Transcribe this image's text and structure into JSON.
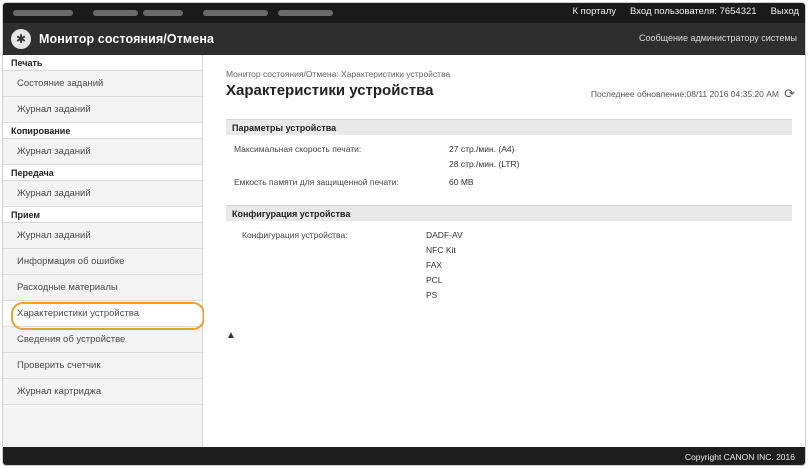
{
  "topbar": {
    "portal": "К порталу",
    "user": "Вход пользователя: 7654321",
    "logout": "Выход"
  },
  "header": {
    "title": "Монитор состояния/Отмена",
    "admin_msg": "Сообщение администратору системы"
  },
  "sidebar": {
    "sections": [
      {
        "heading": "Печать",
        "items": [
          "Состояние заданий",
          "Журнал заданий"
        ]
      },
      {
        "heading": "Копирование",
        "items": [
          "Журнал заданий"
        ]
      },
      {
        "heading": "Передача",
        "items": [
          "Журнал заданий"
        ]
      },
      {
        "heading": "Прием",
        "items": [
          "Журнал заданий"
        ]
      }
    ],
    "extra_items": [
      "Информация об ошибке",
      "Расходные материалы",
      "Характеристики устройства",
      "Сведения об устройстве",
      "Проверить счетчик",
      "Журнал картриджа"
    ]
  },
  "main": {
    "breadcrumb": "Монитор состояния/Отмена: Характеристики устройства",
    "title": "Характеристики устройства",
    "last_updated": "Последнее обновление:08/11 2016 04:35:20 AM",
    "params": {
      "heading": "Параметры устройства",
      "speed_label": "Максимальная скорость печати:",
      "speed_a4": "27 стр./мин. (A4)",
      "speed_ltr": "28 стр./мин. (LTR)",
      "memory_label": "Емкость памяти для защищенной печати:",
      "memory_value": "60 MB"
    },
    "config": {
      "heading": "Конфигурация устройства",
      "label": "Конфигурация устройства:",
      "items": [
        "DADF-AV",
        "NFC Kit",
        "FAX",
        "PCL",
        "PS"
      ]
    },
    "back_to_top": "▲"
  },
  "footer": {
    "copyright": "Copyright CANON INC. 2016"
  }
}
